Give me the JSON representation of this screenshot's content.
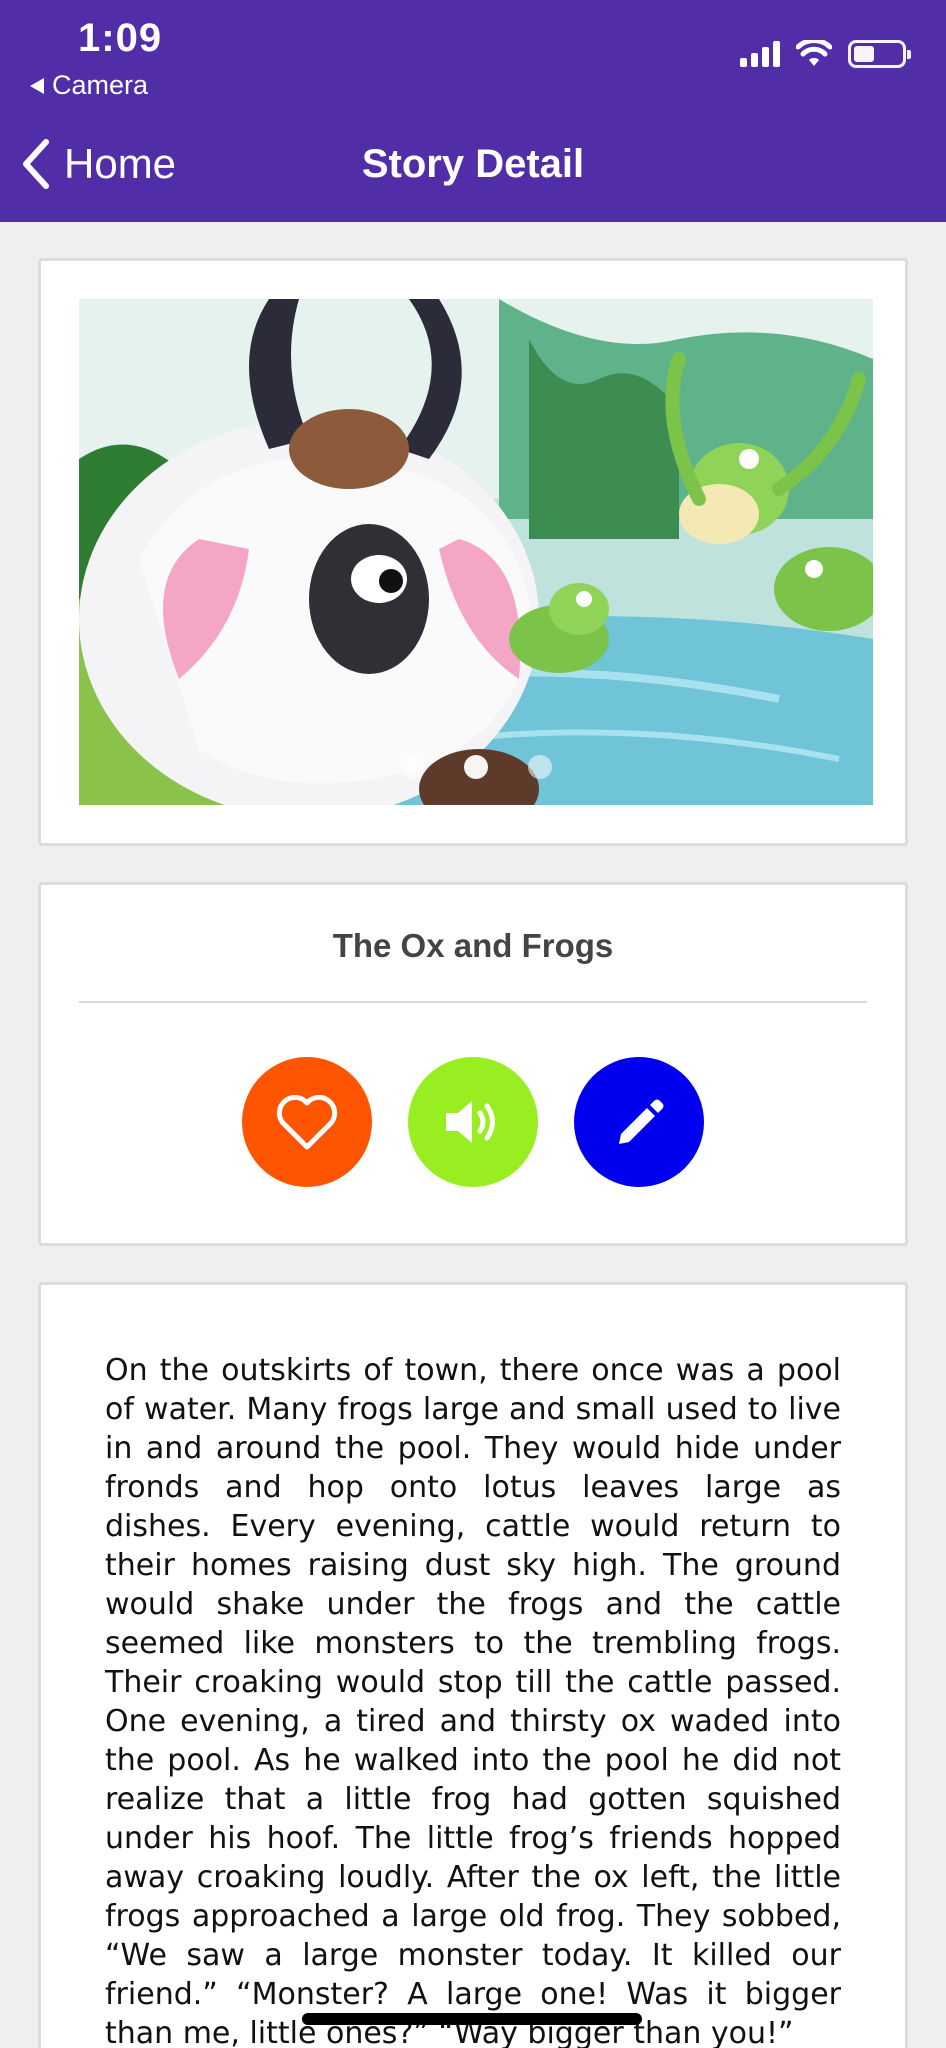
{
  "status_bar": {
    "time": "1:09",
    "back_app": "Camera"
  },
  "nav": {
    "back_label": "Home",
    "title": "Story Detail"
  },
  "carousel": {
    "image": "ox-and-frogs-illustration",
    "slides": 3,
    "active_index": 1
  },
  "story": {
    "title": "The Ox and Frogs",
    "text": "On the outskirts of town, there once was a pool of water. Many frogs large and small used to live in and around the pool. They would hide under fronds and hop onto lotus leaves large as dishes. Every evening, cattle would return to their homes raising dust sky high. The ground would shake under the frogs and the cattle seemed like monsters to the trembling frogs. Their croaking would stop till the cattle passed. One evening, a tired and thirsty ox waded into the pool. As he walked into the pool he did not realize that a little frog had gotten squished under his hoof. The little frog’s friends hopped away croaking loudly. After the ox left, the little frogs approached a large old frog. They sobbed, “We saw a large monster today. It killed our friend.” “Monster? A large one! Was it bigger than me, little ones?” “Way bigger than you!”"
  },
  "actions": [
    {
      "name": "favorite",
      "icon": "heart-icon",
      "color": "#ff5500"
    },
    {
      "name": "listen",
      "icon": "speaker-icon",
      "color": "#99ee22"
    },
    {
      "name": "edit",
      "icon": "pencil-icon",
      "color": "#0000ee"
    }
  ],
  "colors": {
    "header": "#512da8",
    "background": "#efefef"
  }
}
